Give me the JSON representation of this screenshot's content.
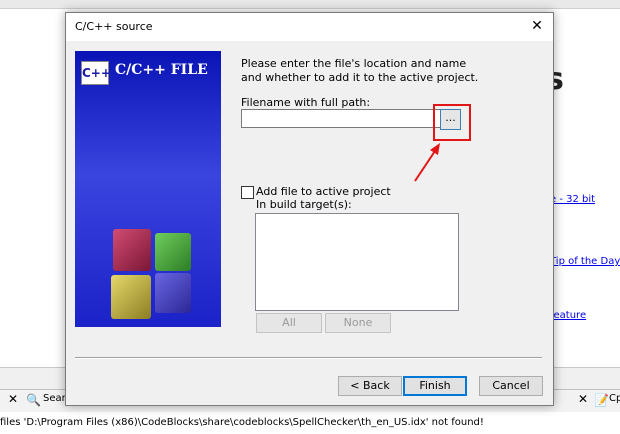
{
  "background": {
    "heading_fragment": "s",
    "links": [
      "e - 32 bit",
      "Tip of the Day",
      "feature"
    ],
    "tabs": {
      "search_fragment": "Sear",
      "right_fragment": "Cp"
    },
    "status_text": "files 'D:\\Program Files (x86)\\CodeBlocks\\share\\codeblocks\\SpellChecker\\th_en_US.idx' not found!"
  },
  "dialog": {
    "title": "C/C++ source",
    "close_glyph": "✕",
    "banner": {
      "logo_text": "C++",
      "title": "C/C++ FILE"
    },
    "intro": "Please enter the file's location and name and whether to add it to the active project.",
    "filename_label": "Filename with full path:",
    "filename_value": "",
    "browse_label": "...",
    "add_to_project_label": "Add file to active project",
    "add_to_project_checked": false,
    "build_target_label": "In build target(s):",
    "all_label": "All",
    "none_label": "None",
    "back_label": "< Back",
    "finish_label": "Finish",
    "cancel_label": "Cancel"
  },
  "annotation": {
    "highlight_color": "#e21616"
  }
}
